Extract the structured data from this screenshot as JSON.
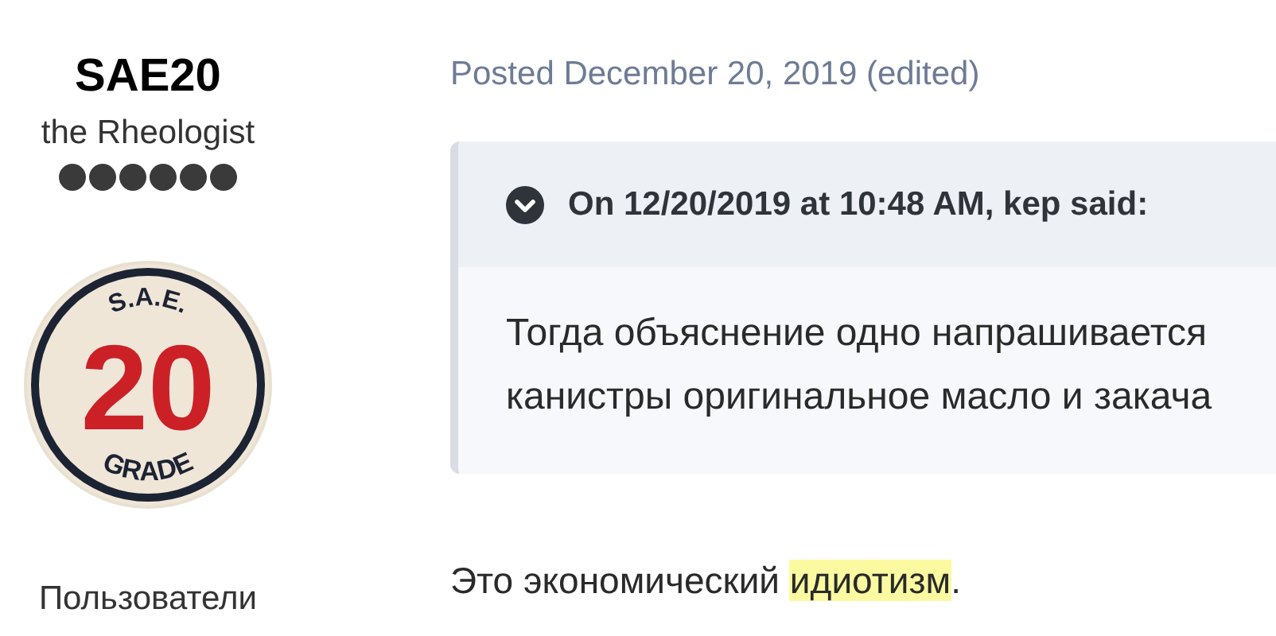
{
  "author": {
    "name": "SAE20",
    "title": "the Rheologist",
    "stars": 6,
    "avatar": {
      "top": "S.A.E.",
      "number": "20",
      "bottom": "GRADE"
    },
    "group": "Пользователи"
  },
  "post": {
    "meta": "Posted December 20, 2019 (edited)",
    "quote": {
      "expanded": true,
      "header": "On 12/20/2019 at 10:48 AM, kep said:",
      "lines": [
        "Тогда объяснение одно напрашивается",
        "канистры оригинальное масло и закача"
      ]
    },
    "body": [
      {
        "text": "Это экономический ",
        "highlighted": false
      },
      {
        "text": "идиотизм",
        "highlighted": true
      },
      {
        "text": ".",
        "highlighted": false
      }
    ]
  }
}
